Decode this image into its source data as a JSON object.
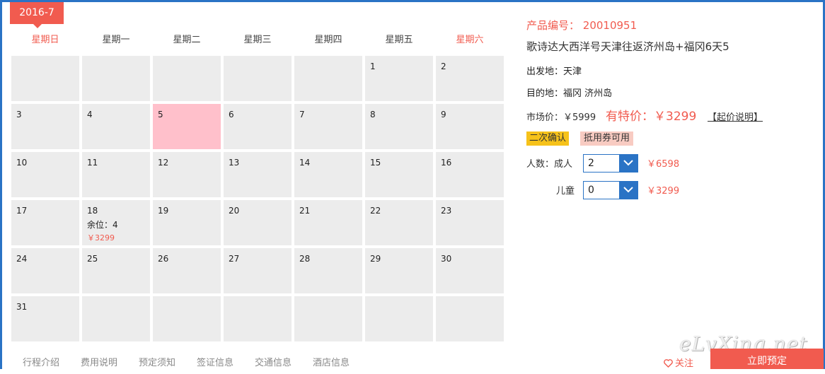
{
  "calendar": {
    "month_tab": "2016-7",
    "weekdays": [
      "星期日",
      "星期一",
      "星期二",
      "星期三",
      "星期四",
      "星期五",
      "星期六"
    ],
    "days": [
      "",
      "",
      "",
      "",
      "",
      "1",
      "2",
      "3",
      "4",
      "5",
      "6",
      "7",
      "8",
      "9",
      "10",
      "11",
      "12",
      "13",
      "14",
      "15",
      "16",
      "17",
      "18",
      "19",
      "20",
      "21",
      "22",
      "23",
      "24",
      "25",
      "26",
      "27",
      "28",
      "29",
      "30",
      "31",
      "",
      "",
      "",
      "",
      "",
      ""
    ],
    "selected_day": "5",
    "availability": {
      "day": "18",
      "seats": "余位：4",
      "price": "￥3299"
    }
  },
  "tabs": [
    "行程介绍",
    "费用说明",
    "预定须知",
    "签证信息",
    "交通信息",
    "酒店信息"
  ],
  "product": {
    "id_label": "产品编号：",
    "id_value": "20010951",
    "name": "歌诗达大西洋号天津往返济州岛+福冈6天5",
    "departure": "出发地：天津",
    "destination": "目的地：福冈 济州岛",
    "market_price": "市场价：￥5999",
    "special_price": "有特价：￥3299",
    "price_explain": "【起价说明】",
    "badges": [
      "二次确认",
      "抵用券可用"
    ]
  },
  "booking": {
    "adults_label": "人数：成人",
    "adults_value": "2",
    "adults_total": "￥6598",
    "children_label": "儿童",
    "children_value": "0",
    "children_total": "￥3299"
  },
  "actions": {
    "follow": "关注",
    "book": "立即预定"
  },
  "watermark": "eLvXing.net",
  "colors": {
    "accent": "#f15b4f",
    "primary": "#2a73c5",
    "cell": "#ececec",
    "selected": "#ffc0cb"
  }
}
